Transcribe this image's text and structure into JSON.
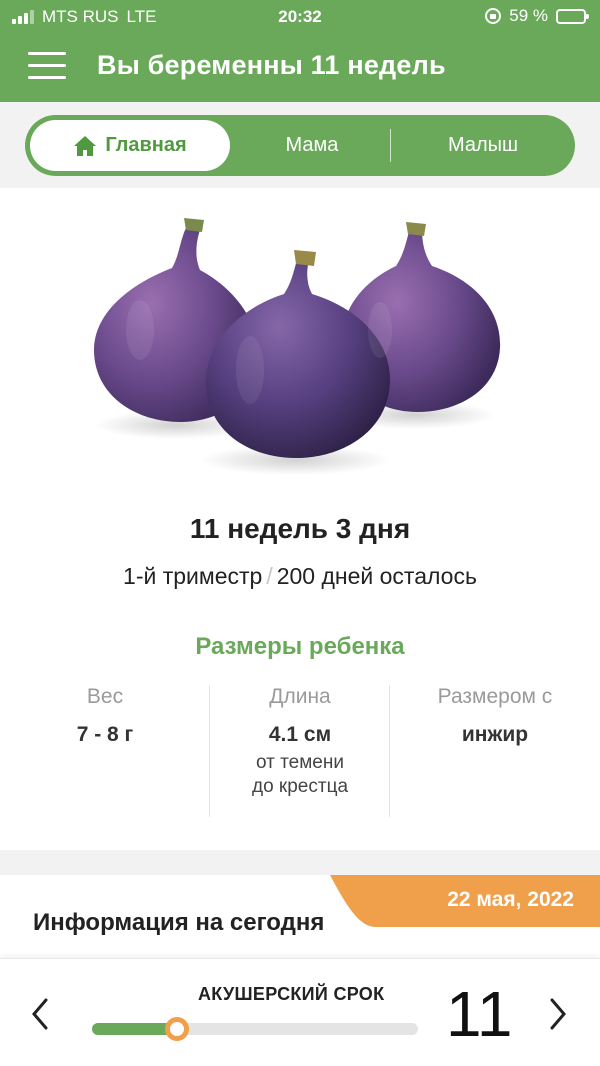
{
  "status_bar": {
    "carrier": "MTS RUS",
    "network": "LTE",
    "time": "20:32",
    "battery": "59 %",
    "battery_level": 0.59
  },
  "header": {
    "title": "Вы беременны 11 недель",
    "menu_icon": "hamburger-menu-icon"
  },
  "tabs": [
    {
      "label": "Главная",
      "icon": "home-icon",
      "active": true
    },
    {
      "label": "Мама",
      "active": false
    },
    {
      "label": "Малыш",
      "active": false
    }
  ],
  "hero": {
    "image": "figs-illustration",
    "week_title": "11 недель 3 дня",
    "trimester": "1-й триместр",
    "separator": "/",
    "days_left": "200 дней осталось"
  },
  "sizes": {
    "title": "Размеры ребенка",
    "weight": {
      "label": "Вес",
      "value": "7 - 8 г"
    },
    "length": {
      "label": "Длина",
      "value": "4.1 см",
      "note_line1": "от темени",
      "note_line2": "до крестца"
    },
    "compare": {
      "label": "Размером с",
      "value": "инжир"
    }
  },
  "today": {
    "date": "22 мая, 2022",
    "title": "Информация на сегодня"
  },
  "term": {
    "label": "АКУШЕРСКИЙ СРОК",
    "week": "11",
    "progress": 0.26
  },
  "colors": {
    "brand_green": "#6aa95a",
    "accent_orange": "#f0a04b"
  }
}
